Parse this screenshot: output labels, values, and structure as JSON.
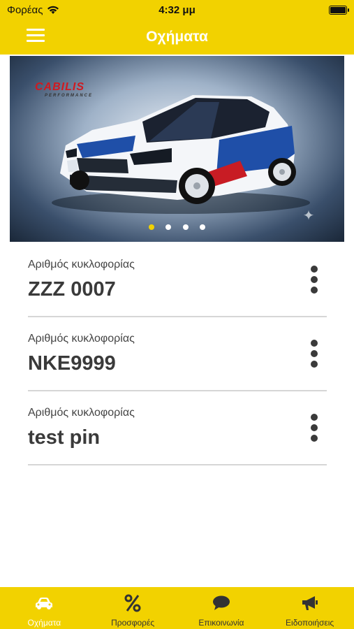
{
  "status_bar": {
    "carrier": "Φορέας",
    "time": "4:32 μμ"
  },
  "header": {
    "title": "Οχήματα"
  },
  "carousel": {
    "brand": "CABILIS",
    "brand_sub": "PERFORMANCE",
    "page_count": 4,
    "active_page": 1
  },
  "vehicles": [
    {
      "label": "Αριθμός κυκλοφορίας",
      "plate": "ZZZ 0007"
    },
    {
      "label": "Αριθμός κυκλοφορίας",
      "plate": "NKE9999"
    },
    {
      "label": "Αριθμός κυκλοφορίας",
      "plate": "test pin"
    }
  ],
  "tabs": [
    {
      "label": "Οχήματα",
      "icon": "car-icon",
      "active": true
    },
    {
      "label": "Προσφορές",
      "icon": "percent-icon",
      "active": false
    },
    {
      "label": "Επικοινωνία",
      "icon": "chat-icon",
      "active": false
    },
    {
      "label": "Ειδοποιήσεις",
      "icon": "megaphone-icon",
      "active": false
    }
  ],
  "colors": {
    "accent": "#f2d200",
    "text": "#3a3a3a",
    "divider": "#d6d6d6"
  }
}
